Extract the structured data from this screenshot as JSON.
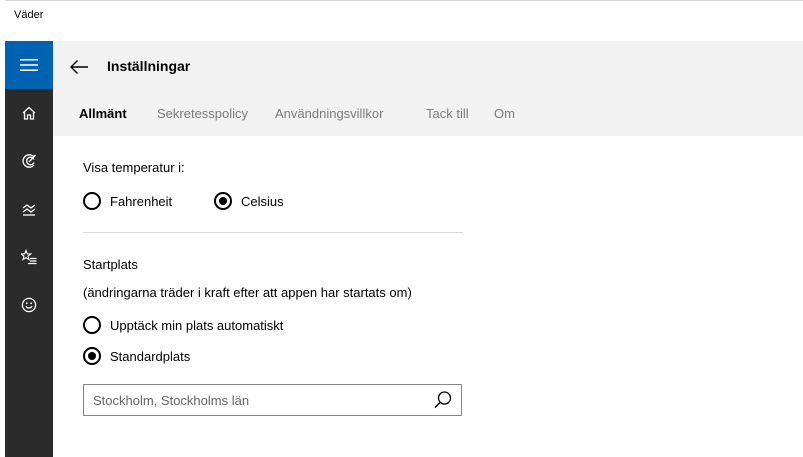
{
  "app": {
    "title": "Väder"
  },
  "rail": {
    "icons": [
      "hamburger-menu-icon",
      "home-icon",
      "forecast-icon",
      "historical-weather-icon",
      "favorites-icon",
      "feedback-icon"
    ]
  },
  "header": {
    "title": "Inställningar",
    "back_icon": "back-arrow-icon"
  },
  "tabs": [
    {
      "label": "Allmänt",
      "active": true
    },
    {
      "label": "Sekretesspolicy",
      "active": false
    },
    {
      "label": "Användningsvillkor",
      "active": false
    },
    {
      "label": "Tack till",
      "active": false
    },
    {
      "label": "Om",
      "active": false
    }
  ],
  "temperature": {
    "label": "Visa temperatur i:",
    "options": [
      {
        "label": "Fahrenheit",
        "selected": false
      },
      {
        "label": "Celsius",
        "selected": true
      }
    ]
  },
  "startplats": {
    "label": "Startplats",
    "note": "(ändringarna träder i kraft efter att appen har startats om)",
    "options": [
      {
        "label": "Upptäck min plats automatiskt",
        "selected": false
      },
      {
        "label": "Standardplats",
        "selected": true
      }
    ],
    "search_value": "Stockholm, Stockholms län"
  },
  "colors": {
    "accent": "#0063b1",
    "rail": "#2b2b2b",
    "header": "#f2f2f2"
  }
}
